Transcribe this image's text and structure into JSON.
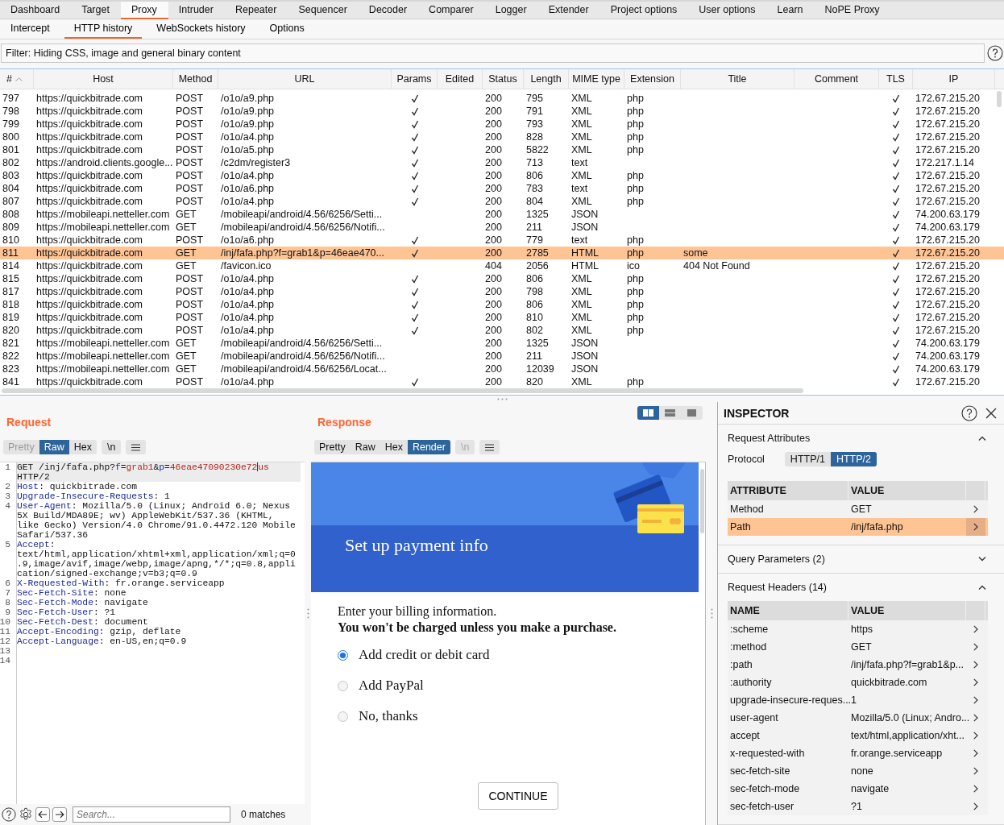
{
  "main_tabs": [
    {
      "label": "Dashboard",
      "selected": false
    },
    {
      "label": "Target",
      "selected": false
    },
    {
      "label": "Proxy",
      "selected": true
    },
    {
      "label": "Intruder",
      "selected": false
    },
    {
      "label": "Repeater",
      "selected": false
    },
    {
      "label": "Sequencer",
      "selected": false
    },
    {
      "label": "Decoder",
      "selected": false
    },
    {
      "label": "Comparer",
      "selected": false
    },
    {
      "label": "Logger",
      "selected": false
    },
    {
      "label": "Extender",
      "selected": false
    },
    {
      "label": "Project options",
      "selected": false
    },
    {
      "label": "User options",
      "selected": false
    },
    {
      "label": "Learn",
      "selected": false
    },
    {
      "label": "NoPE Proxy",
      "selected": false
    }
  ],
  "sub_tabs": [
    {
      "label": "Intercept",
      "selected": false
    },
    {
      "label": "HTTP history",
      "selected": true
    },
    {
      "label": "WebSockets history",
      "selected": false
    },
    {
      "label": "Options",
      "selected": false
    }
  ],
  "filter": "Filter: Hiding CSS, image and general binary content",
  "table": {
    "columns": [
      "#",
      "Host",
      "Method",
      "URL",
      "Params",
      "Edited",
      "Status",
      "Length",
      "MIME type",
      "Extension",
      "Title",
      "Comment",
      "TLS",
      "IP"
    ],
    "rows": [
      {
        "num": "797",
        "host": "https://quickbitrade.com",
        "method": "POST",
        "url": "/o1o/a9.php",
        "params": true,
        "status": "200",
        "length": "795",
        "mime": "XML",
        "ext": "php",
        "tls": true,
        "ip": "172.67.215.20",
        "selected": false
      },
      {
        "num": "798",
        "host": "https://quickbitrade.com",
        "method": "POST",
        "url": "/o1o/a9.php",
        "params": true,
        "status": "200",
        "length": "791",
        "mime": "XML",
        "ext": "php",
        "tls": true,
        "ip": "172.67.215.20",
        "selected": false
      },
      {
        "num": "799",
        "host": "https://quickbitrade.com",
        "method": "POST",
        "url": "/o1o/a9.php",
        "params": true,
        "status": "200",
        "length": "793",
        "mime": "XML",
        "ext": "php",
        "tls": true,
        "ip": "172.67.215.20",
        "selected": false
      },
      {
        "num": "800",
        "host": "https://quickbitrade.com",
        "method": "POST",
        "url": "/o1o/a4.php",
        "params": true,
        "status": "200",
        "length": "828",
        "mime": "XML",
        "ext": "php",
        "tls": true,
        "ip": "172.67.215.20",
        "selected": false
      },
      {
        "num": "801",
        "host": "https://quickbitrade.com",
        "method": "POST",
        "url": "/o1o/a5.php",
        "params": true,
        "status": "200",
        "length": "5822",
        "mime": "XML",
        "ext": "php",
        "tls": true,
        "ip": "172.67.215.20",
        "selected": false
      },
      {
        "num": "802",
        "host": "https://android.clients.google...",
        "method": "POST",
        "url": "/c2dm/register3",
        "params": true,
        "status": "200",
        "length": "713",
        "mime": "text",
        "tls": true,
        "ip": "172.217.1.14",
        "selected": false
      },
      {
        "num": "803",
        "host": "https://quickbitrade.com",
        "method": "POST",
        "url": "/o1o/a4.php",
        "params": true,
        "status": "200",
        "length": "806",
        "mime": "XML",
        "ext": "php",
        "tls": true,
        "ip": "172.67.215.20",
        "selected": false
      },
      {
        "num": "804",
        "host": "https://quickbitrade.com",
        "method": "POST",
        "url": "/o1o/a6.php",
        "params": true,
        "status": "200",
        "length": "783",
        "mime": "text",
        "ext": "php",
        "tls": true,
        "ip": "172.67.215.20",
        "selected": false
      },
      {
        "num": "807",
        "host": "https://quickbitrade.com",
        "method": "POST",
        "url": "/o1o/a4.php",
        "params": true,
        "status": "200",
        "length": "804",
        "mime": "XML",
        "ext": "php",
        "tls": true,
        "ip": "172.67.215.20",
        "selected": false
      },
      {
        "num": "808",
        "host": "https://mobileapi.netteller.com",
        "method": "GET",
        "url": "/mobileapi/android/4.56/6256/Setti...",
        "params": false,
        "status": "200",
        "length": "1325",
        "mime": "JSON",
        "tls": true,
        "ip": "74.200.63.179",
        "selected": false
      },
      {
        "num": "809",
        "host": "https://mobileapi.netteller.com",
        "method": "GET",
        "url": "/mobileapi/android/4.56/6256/Notifi...",
        "params": false,
        "status": "200",
        "length": "211",
        "mime": "JSON",
        "tls": true,
        "ip": "74.200.63.179",
        "selected": false
      },
      {
        "num": "810",
        "host": "https://quickbitrade.com",
        "method": "POST",
        "url": "/o1o/a6.php",
        "params": true,
        "status": "200",
        "length": "779",
        "mime": "text",
        "ext": "php",
        "tls": true,
        "ip": "172.67.215.20",
        "selected": false
      },
      {
        "num": "811",
        "host": "https://quickbitrade.com",
        "method": "GET",
        "url": "/inj/fafa.php?f=grab1&p=46eae470...",
        "params": true,
        "status": "200",
        "length": "2785",
        "mime": "HTML",
        "ext": "php",
        "title": "some",
        "tls": true,
        "ip": "172.67.215.20",
        "selected": true
      },
      {
        "num": "814",
        "host": "https://quickbitrade.com",
        "method": "GET",
        "url": "/favicon.ico",
        "params": false,
        "status": "404",
        "length": "2056",
        "mime": "HTML",
        "ext": "ico",
        "title": "404 Not Found",
        "tls": true,
        "ip": "172.67.215.20",
        "selected": false
      },
      {
        "num": "815",
        "host": "https://quickbitrade.com",
        "method": "POST",
        "url": "/o1o/a4.php",
        "params": true,
        "status": "200",
        "length": "806",
        "mime": "XML",
        "ext": "php",
        "tls": true,
        "ip": "172.67.215.20",
        "selected": false
      },
      {
        "num": "817",
        "host": "https://quickbitrade.com",
        "method": "POST",
        "url": "/o1o/a4.php",
        "params": true,
        "status": "200",
        "length": "798",
        "mime": "XML",
        "ext": "php",
        "tls": true,
        "ip": "172.67.215.20",
        "selected": false
      },
      {
        "num": "818",
        "host": "https://quickbitrade.com",
        "method": "POST",
        "url": "/o1o/a4.php",
        "params": true,
        "status": "200",
        "length": "806",
        "mime": "XML",
        "ext": "php",
        "tls": true,
        "ip": "172.67.215.20",
        "selected": false
      },
      {
        "num": "819",
        "host": "https://quickbitrade.com",
        "method": "POST",
        "url": "/o1o/a4.php",
        "params": true,
        "status": "200",
        "length": "810",
        "mime": "XML",
        "ext": "php",
        "tls": true,
        "ip": "172.67.215.20",
        "selected": false
      },
      {
        "num": "820",
        "host": "https://quickbitrade.com",
        "method": "POST",
        "url": "/o1o/a4.php",
        "params": true,
        "status": "200",
        "length": "802",
        "mime": "XML",
        "ext": "php",
        "tls": true,
        "ip": "172.67.215.20",
        "selected": false
      },
      {
        "num": "821",
        "host": "https://mobileapi.netteller.com",
        "method": "GET",
        "url": "/mobileapi/android/4.56/6256/Setti...",
        "params": false,
        "status": "200",
        "length": "1325",
        "mime": "JSON",
        "tls": true,
        "ip": "74.200.63.179",
        "selected": false
      },
      {
        "num": "822",
        "host": "https://mobileapi.netteller.com",
        "method": "GET",
        "url": "/mobileapi/android/4.56/6256/Notifi...",
        "params": false,
        "status": "200",
        "length": "211",
        "mime": "JSON",
        "tls": true,
        "ip": "74.200.63.179",
        "selected": false
      },
      {
        "num": "823",
        "host": "https://mobileapi.netteller.com",
        "method": "GET",
        "url": "/mobileapi/android/4.56/6256/Locat...",
        "params": false,
        "status": "200",
        "length": "12039",
        "mime": "JSON",
        "tls": true,
        "ip": "74.200.63.179",
        "selected": false
      },
      {
        "num": "841",
        "host": "https://quickbitrade.com",
        "method": "POST",
        "url": "/o1o/a4.php",
        "params": true,
        "status": "200",
        "length": "820",
        "mime": "XML",
        "ext": "php",
        "tls": true,
        "ip": "172.67.215.20",
        "selected": false
      }
    ]
  },
  "request": {
    "title": "Request",
    "view_tabs": [
      {
        "label": "Pretty",
        "selected": false,
        "disabled": true
      },
      {
        "label": "Raw",
        "selected": true,
        "disabled": false
      },
      {
        "label": "Hex",
        "selected": false,
        "disabled": false
      }
    ],
    "newline_button": {
      "label": "\\n",
      "disabled": false
    },
    "lines": [
      {
        "number": "1",
        "segments": [
          {
            "kind": "text",
            "text": "GET /inj/fafa.php?"
          },
          {
            "kind": "name",
            "text": "f"
          },
          {
            "kind": "text",
            "text": "="
          },
          {
            "kind": "value",
            "text": "grab1"
          },
          {
            "kind": "text",
            "text": "&"
          },
          {
            "kind": "name",
            "text": "p"
          },
          {
            "kind": "text",
            "text": "="
          },
          {
            "kind": "value",
            "text": "46eae47090230e72"
          },
          {
            "kind": "caret"
          },
          {
            "kind": "value",
            "text": "us"
          },
          {
            "kind": "text",
            "text": " HTTP/2"
          }
        ]
      },
      {
        "number": "2",
        "segments": [
          {
            "kind": "name",
            "text": "Host"
          },
          {
            "kind": "text",
            "text": ": quickbitrade.com"
          }
        ]
      },
      {
        "number": "3",
        "segments": [
          {
            "kind": "name",
            "text": "Upgrade-Insecure-Requests"
          },
          {
            "kind": "text",
            "text": ": 1"
          }
        ]
      },
      {
        "number": "4",
        "segments": [
          {
            "kind": "name",
            "text": "User-Agent"
          },
          {
            "kind": "text",
            "text": ": Mozilla/5.0 (Linux; Android 6.0; Nexus 5X Build/MDA89E; wv) AppleWebKit/537.36 (KHTML, like Gecko) Version/4.0 Chrome/91.0.4472.120 Mobile Safari/537.36"
          }
        ]
      },
      {
        "number": "5",
        "segments": [
          {
            "kind": "name",
            "text": "Accept"
          },
          {
            "kind": "text",
            "text": ": text/html,application/xhtml+xml,application/xml;q=0.9,image/avif,image/webp,image/apng,*/*;q=0.8,application/signed-exchange;v=b3;q=0.9"
          }
        ]
      },
      {
        "number": "6",
        "segments": [
          {
            "kind": "name",
            "text": "X-Requested-With"
          },
          {
            "kind": "text",
            "text": ": fr.orange.serviceapp"
          }
        ]
      },
      {
        "number": "7",
        "segments": [
          {
            "kind": "name",
            "text": "Sec-Fetch-Site"
          },
          {
            "kind": "text",
            "text": ": none"
          }
        ]
      },
      {
        "number": "8",
        "segments": [
          {
            "kind": "name",
            "text": "Sec-Fetch-Mode"
          },
          {
            "kind": "text",
            "text": ": navigate"
          }
        ]
      },
      {
        "number": "9",
        "segments": [
          {
            "kind": "name",
            "text": "Sec-Fetch-User"
          },
          {
            "kind": "text",
            "text": ": ?1"
          }
        ]
      },
      {
        "number": "10",
        "segments": [
          {
            "kind": "name",
            "text": "Sec-Fetch-Dest"
          },
          {
            "kind": "text",
            "text": ": document"
          }
        ]
      },
      {
        "number": "11",
        "segments": [
          {
            "kind": "name",
            "text": "Accept-Encoding"
          },
          {
            "kind": "text",
            "text": ": gzip, deflate"
          }
        ]
      },
      {
        "number": "12",
        "segments": [
          {
            "kind": "name",
            "text": "Accept-Language"
          },
          {
            "kind": "text",
            "text": ": en-US,en;q=0.9"
          }
        ]
      },
      {
        "number": "13"
      },
      {
        "number": "14"
      }
    ],
    "search": {
      "placeholder": "Search..."
    },
    "matches": "0 matches"
  },
  "response": {
    "title": "Response",
    "layout_buttons": [
      {
        "kind": "columns",
        "selected": true
      },
      {
        "kind": "rows",
        "selected": false
      },
      {
        "kind": "single",
        "selected": false
      }
    ],
    "view_tabs": [
      {
        "label": "Pretty",
        "selected": false,
        "disabled": false
      },
      {
        "label": "Raw",
        "selected": false,
        "disabled": false
      },
      {
        "label": "Hex",
        "selected": false,
        "disabled": false
      },
      {
        "label": "Render",
        "selected": true,
        "disabled": false
      }
    ],
    "newline_button": {
      "label": "\\n",
      "disabled": true
    },
    "render": {
      "heading": "Set up payment info",
      "paragraphs": [
        {
          "kind": "plain",
          "text": "Enter your billing information."
        },
        {
          "kind": "bold",
          "text": "You won't be charged unless you make a purchase."
        }
      ],
      "options": [
        {
          "label": "Add credit or debit card",
          "selected": true
        },
        {
          "label": "Add PayPal",
          "selected": false
        },
        {
          "label": "No, thanks",
          "selected": false
        }
      ],
      "button": "CONTINUE"
    }
  },
  "inspector": {
    "title": "INSPECTOR",
    "sections": [
      {
        "title": "Request Attributes",
        "expanded": true,
        "protocol": {
          "label": "Protocol",
          "options": [
            {
              "label": "HTTP/1",
              "selected": false
            },
            {
              "label": "HTTP/2",
              "selected": true
            }
          ]
        },
        "table": {
          "columns": [
            "ATTRIBUTE",
            "VALUE"
          ],
          "rows": [
            {
              "name": "Method",
              "value": "GET",
              "selected": false
            },
            {
              "name": "Path",
              "value": "/inj/fafa.php",
              "selected": true
            }
          ]
        }
      },
      {
        "title": "Query Parameters (2)",
        "expanded": false
      },
      {
        "title": "Request Headers (14)",
        "expanded": true,
        "table": {
          "columns": [
            "NAME",
            "VALUE"
          ],
          "rows": [
            {
              "name": ":scheme",
              "value": "https",
              "selected": false
            },
            {
              "name": ":method",
              "value": "GET",
              "selected": false
            },
            {
              "name": ":path",
              "value": "/inj/fafa.php?f=grab1&p...",
              "selected": false
            },
            {
              "name": ":authority",
              "value": "quickbitrade.com",
              "selected": false
            },
            {
              "name": "upgrade-insecure-reques...",
              "value": "1",
              "selected": false
            },
            {
              "name": "user-agent",
              "value": "Mozilla/5.0 (Linux; Andro...",
              "selected": false
            },
            {
              "name": "accept",
              "value": "text/html,application/xht...",
              "selected": false
            },
            {
              "name": "x-requested-with",
              "value": "fr.orange.serviceapp",
              "selected": false
            },
            {
              "name": "sec-fetch-site",
              "value": "none",
              "selected": false
            },
            {
              "name": "sec-fetch-mode",
              "value": "navigate",
              "selected": false
            },
            {
              "name": "sec-fetch-user",
              "value": "?1",
              "selected": false
            }
          ]
        }
      }
    ]
  }
}
